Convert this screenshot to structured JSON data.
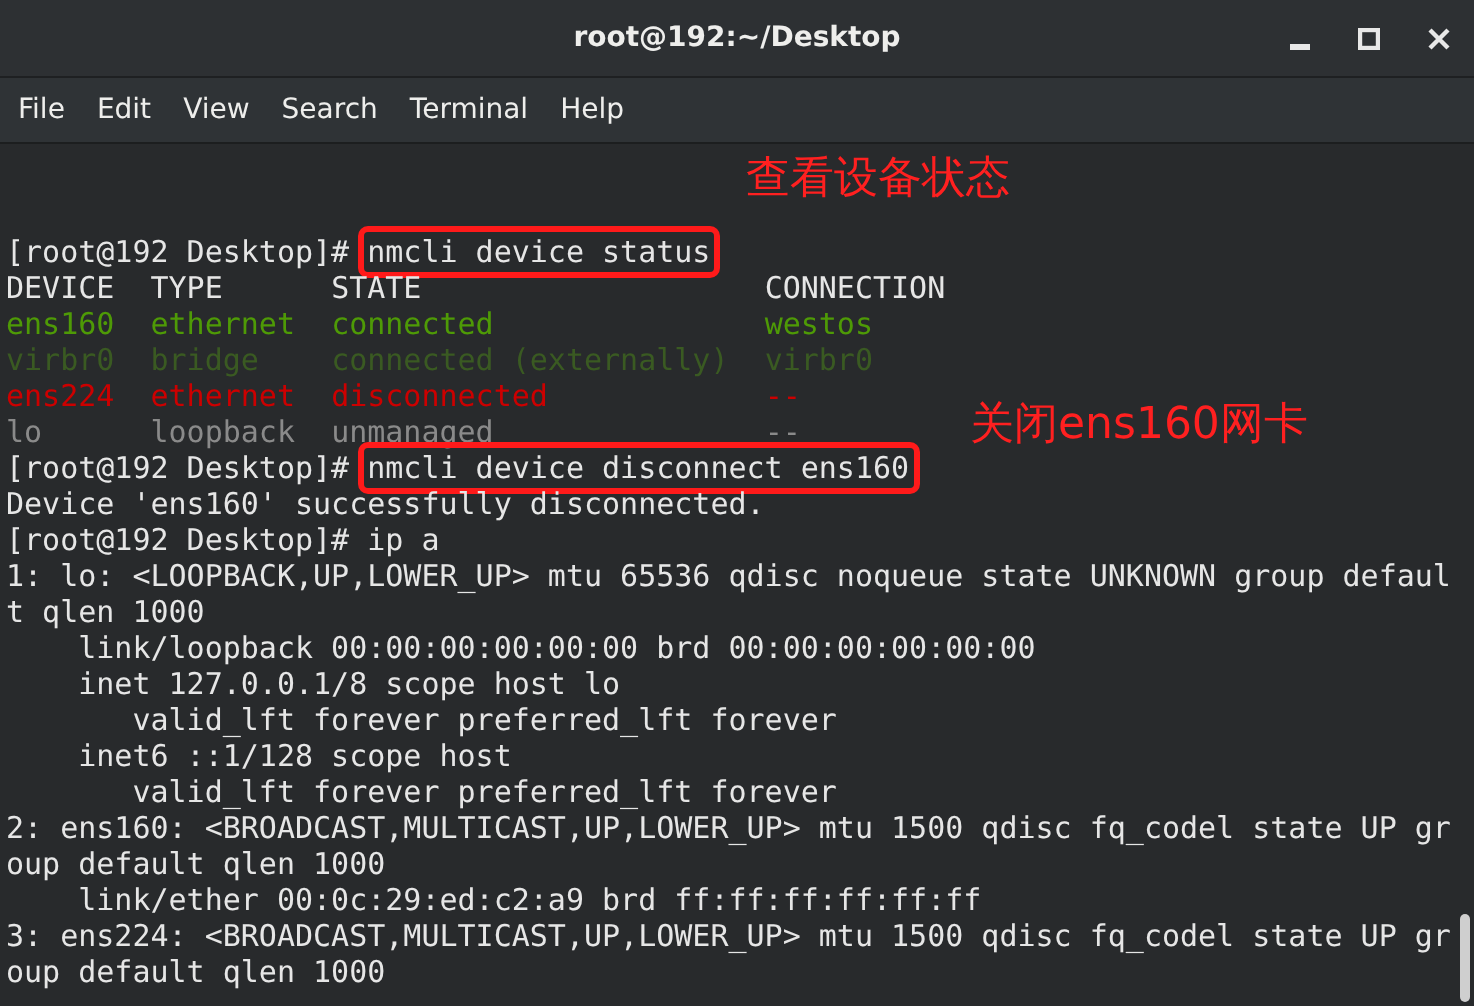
{
  "window": {
    "title": "root@192:~/Desktop"
  },
  "menu": [
    "File",
    "Edit",
    "View",
    "Search",
    "Terminal",
    "Help"
  ],
  "lines": [
    {
      "kind": "prompt",
      "prompt": "[root@192 Desktop]# ",
      "command": "nmcli device status",
      "highlighted": true,
      "note": "查看设备状态"
    },
    {
      "kind": "row",
      "cells": [
        "DEVICE",
        "TYPE",
        "STATE",
        "CONNECTION"
      ],
      "color": "#e6e6e6"
    },
    {
      "kind": "row",
      "cells": [
        "ens160",
        "ethernet",
        "connected",
        "westos"
      ],
      "color": "#4e9a06"
    },
    {
      "kind": "row",
      "cells": [
        "virbr0",
        "bridge",
        "connected (externally)",
        "virbr0"
      ],
      "color": "#3a5a22"
    },
    {
      "kind": "row",
      "cells": [
        "ens224",
        "ethernet",
        "disconnected",
        "--"
      ],
      "color": "#cc0000"
    },
    {
      "kind": "row",
      "cells": [
        "lo",
        "loopback",
        "unmanaged",
        "--"
      ],
      "color": "#8a8a8a"
    },
    {
      "kind": "prompt",
      "prompt": "[root@192 Desktop]# ",
      "command": "nmcli device disconnect ens160",
      "highlighted": true,
      "note": "关闭ens160网卡"
    },
    {
      "kind": "output",
      "text": "Device 'ens160' successfully disconnected."
    },
    {
      "kind": "prompt",
      "prompt": "[root@192 Desktop]# ",
      "command": "ip a",
      "highlighted": false
    },
    {
      "kind": "output",
      "text": "1: lo: <LOOPBACK,UP,LOWER_UP> mtu 65536 qdisc noqueue state UNKNOWN group defaul"
    },
    {
      "kind": "output",
      "text": "t qlen 1000"
    },
    {
      "kind": "output",
      "text": "    link/loopback 00:00:00:00:00:00 brd 00:00:00:00:00:00"
    },
    {
      "kind": "output",
      "text": "    inet 127.0.0.1/8 scope host lo"
    },
    {
      "kind": "output",
      "text": "       valid_lft forever preferred_lft forever"
    },
    {
      "kind": "output",
      "text": "    inet6 ::1/128 scope host"
    },
    {
      "kind": "output",
      "text": "       valid_lft forever preferred_lft forever"
    },
    {
      "kind": "output",
      "text": "2: ens160: <BROADCAST,MULTICAST,UP,LOWER_UP> mtu 1500 qdisc fq_codel state UP gr"
    },
    {
      "kind": "output",
      "text": "oup default qlen 1000"
    },
    {
      "kind": "output",
      "text": "    link/ether 00:0c:29:ed:c2:a9 brd ff:ff:ff:ff:ff:ff"
    },
    {
      "kind": "output",
      "text": "3: ens224: <BROADCAST,MULTICAST,UP,LOWER_UP> mtu 1500 qdisc fq_codel state UP gr"
    },
    {
      "kind": "output",
      "text": "oup default qlen 1000"
    }
  ]
}
